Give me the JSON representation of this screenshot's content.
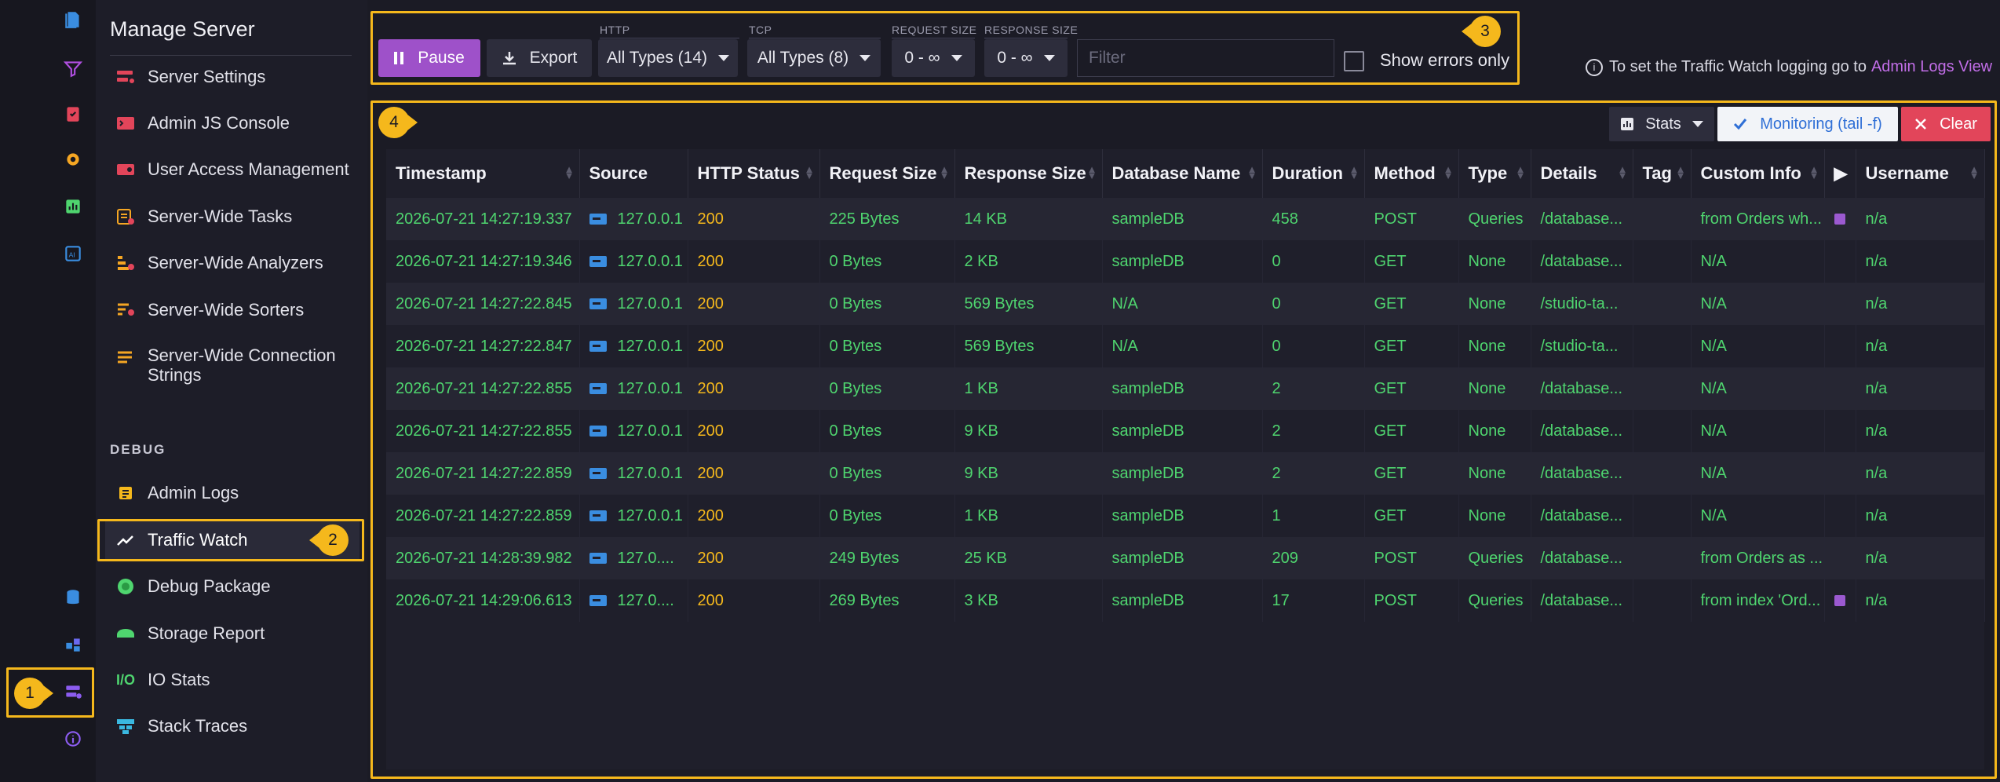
{
  "sidebar": {
    "title": "Manage Server",
    "items": [
      {
        "label": "Server Settings",
        "icon": "server-settings-icon"
      },
      {
        "label": "Admin JS Console",
        "icon": "console-icon"
      },
      {
        "label": "User Access Management",
        "icon": "user-access-icon"
      },
      {
        "label": "Server-Wide Tasks",
        "icon": "tasks-icon"
      },
      {
        "label": "Server-Wide Analyzers",
        "icon": "analyzers-icon"
      },
      {
        "label": "Server-Wide Sorters",
        "icon": "sorters-icon"
      },
      {
        "label": "Server-Wide Connection Strings",
        "icon": "connection-strings-icon"
      }
    ],
    "debug_section": "DEBUG",
    "debug_items": [
      {
        "label": "Admin Logs",
        "icon": "admin-logs-icon"
      },
      {
        "label": "Traffic Watch",
        "icon": "traffic-watch-icon"
      },
      {
        "label": "Debug Package",
        "icon": "debug-package-icon"
      },
      {
        "label": "Storage Report",
        "icon": "storage-report-icon"
      },
      {
        "label": "IO Stats",
        "icon": "io-stats-icon"
      },
      {
        "label": "Stack Traces",
        "icon": "stack-traces-icon"
      }
    ]
  },
  "callouts": {
    "one": "1",
    "two": "2",
    "three": "3",
    "four": "4"
  },
  "toolbar": {
    "pause_label": "Pause",
    "export_label": "Export",
    "http_label": "HTTP",
    "http_value": "All Types (14)",
    "tcp_label": "TCP",
    "tcp_value": "All Types (8)",
    "request_size_label": "REQUEST SIZE",
    "request_size_value": "0 - ∞",
    "response_size_label": "RESPONSE SIZE",
    "response_size_value": "0 - ∞",
    "filter_placeholder": "Filter",
    "show_errors_label": "Show errors only"
  },
  "info_note": {
    "text": "To set the Traffic Watch logging go to",
    "link": "Admin Logs View"
  },
  "panel": {
    "stats_label": "Stats",
    "monitoring_label": "Monitoring (tail -f)",
    "clear_label": "Clear"
  },
  "table": {
    "columns": [
      "Timestamp",
      "Source",
      "HTTP Status",
      "Request Size",
      "Response Size",
      "Database Name",
      "Duration",
      "Method",
      "Type",
      "Details",
      "Tag",
      "Custom Info",
      "▶",
      "Username"
    ],
    "rows": [
      [
        "2026-07-21 14:27:19.337",
        "127.0.0.1",
        "200",
        "225 Bytes",
        "14 KB",
        "sampleDB",
        "458",
        "POST",
        "Queries",
        "/database...",
        "",
        "from Orders wh...",
        "chart",
        "n/a"
      ],
      [
        "2026-07-21 14:27:19.346",
        "127.0.0.1",
        "200",
        "0 Bytes",
        "2 KB",
        "sampleDB",
        "0",
        "GET",
        "None",
        "/database...",
        "",
        "N/A",
        "",
        "n/a"
      ],
      [
        "2026-07-21 14:27:22.845",
        "127.0.0.1",
        "200",
        "0 Bytes",
        "569 Bytes",
        "N/A",
        "0",
        "GET",
        "None",
        "/studio-ta...",
        "",
        "N/A",
        "",
        "n/a"
      ],
      [
        "2026-07-21 14:27:22.847",
        "127.0.0.1",
        "200",
        "0 Bytes",
        "569 Bytes",
        "N/A",
        "0",
        "GET",
        "None",
        "/studio-ta...",
        "",
        "N/A",
        "",
        "n/a"
      ],
      [
        "2026-07-21 14:27:22.855",
        "127.0.0.1",
        "200",
        "0 Bytes",
        "1 KB",
        "sampleDB",
        "2",
        "GET",
        "None",
        "/database...",
        "",
        "N/A",
        "",
        "n/a"
      ],
      [
        "2026-07-21 14:27:22.855",
        "127.0.0.1",
        "200",
        "0 Bytes",
        "9 KB",
        "sampleDB",
        "2",
        "GET",
        "None",
        "/database...",
        "",
        "N/A",
        "",
        "n/a"
      ],
      [
        "2026-07-21 14:27:22.859",
        "127.0.0.1",
        "200",
        "0 Bytes",
        "9 KB",
        "sampleDB",
        "2",
        "GET",
        "None",
        "/database...",
        "",
        "N/A",
        "",
        "n/a"
      ],
      [
        "2026-07-21 14:27:22.859",
        "127.0.0.1",
        "200",
        "0 Bytes",
        "1 KB",
        "sampleDB",
        "1",
        "GET",
        "None",
        "/database...",
        "",
        "N/A",
        "",
        "n/a"
      ],
      [
        "2026-07-21 14:28:39.982",
        "127.0....",
        "200",
        "249 Bytes",
        "25 KB",
        "sampleDB",
        "209",
        "POST",
        "Queries",
        "/database...",
        "",
        "from Orders as ...",
        "",
        "n/a"
      ],
      [
        "2026-07-21 14:29:06.613",
        "127.0....",
        "200",
        "269 Bytes",
        "3 KB",
        "sampleDB",
        "17",
        "POST",
        "Queries",
        "/database...",
        "",
        "from index 'Ord...",
        "chart",
        "n/a"
      ]
    ]
  },
  "colors": {
    "accent": "#f5b81c",
    "pause": "#9e51c9",
    "clear": "#e2455a",
    "row_text": "#4fd56f",
    "status_text": "#f5b81c",
    "link": "#c26ee8"
  }
}
